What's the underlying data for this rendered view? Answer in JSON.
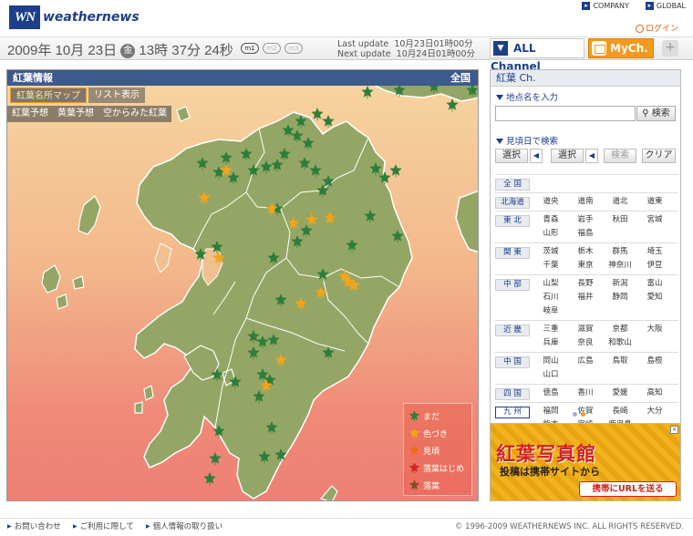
{
  "header": {
    "logo_mark": "WN",
    "logo_text": "weathernews",
    "company": "COMPANY",
    "global": "GLOBAL",
    "login": "ログイン"
  },
  "datebar": {
    "date": "2009年 10月 23日",
    "weekday": "金",
    "time": "13時 37分 24秒",
    "pills": [
      "m1",
      "m2",
      "m3"
    ],
    "last_update_label": "Last update",
    "last_update": "10月23日01時00分",
    "next_update_label": "Next update",
    "next_update": "10月24日01時00分"
  },
  "channels": {
    "all": "ALL Channel",
    "my": "MyCh.",
    "plus": "+"
  },
  "map": {
    "title": "紅葉情報",
    "region": "全国",
    "tabs": [
      "紅葉名所マップ",
      "リスト表示"
    ],
    "subtabs": [
      "紅葉予想",
      "黄葉予想",
      "空からみた紅葉"
    ],
    "legend": [
      {
        "label": "まだ",
        "color": "#2e7d3a"
      },
      {
        "label": "色づき",
        "color": "#f3a41a"
      },
      {
        "label": "見頃",
        "color": "#ef6a1a"
      },
      {
        "label": "落葉はじめ",
        "color": "#d42424"
      },
      {
        "label": "落葉",
        "color": "#8a4a26"
      }
    ]
  },
  "right": {
    "title": "紅葉 Ch.",
    "search_label": "地点名を入力",
    "search_button": "検索",
    "filter_label": "見頃日で検索",
    "select1": "選択",
    "select2": "選択",
    "search2": "検索",
    "clear": "クリア",
    "regions": [
      {
        "name": "全 国",
        "prefs": []
      },
      {
        "name": "北海道",
        "prefs": [
          "道央",
          "道南",
          "道北",
          "道東"
        ]
      },
      {
        "name": "東 北",
        "prefs": [
          "青森",
          "岩手",
          "秋田",
          "宮城",
          "山形",
          "福島"
        ]
      },
      {
        "name": "関 東",
        "prefs": [
          "茨城",
          "栃木",
          "群馬",
          "埼玉",
          "千葉",
          "東京",
          "神奈川",
          "伊豆"
        ]
      },
      {
        "name": "中 部",
        "prefs": [
          "山梨",
          "長野",
          "新潟",
          "富山",
          "石川",
          "福井",
          "静岡",
          "愛知",
          "岐阜"
        ]
      },
      {
        "name": "近 畿",
        "prefs": [
          "三重",
          "滋賀",
          "京都",
          "大阪",
          "兵庫",
          "奈良",
          "和歌山"
        ]
      },
      {
        "name": "中 国",
        "prefs": [
          "岡山",
          "広島",
          "鳥取",
          "島根",
          "山口"
        ]
      },
      {
        "name": "四 国",
        "prefs": [
          "徳島",
          "香川",
          "愛媛",
          "高知"
        ]
      },
      {
        "name": "九 州",
        "prefs": [
          "福岡",
          "佐賀",
          "長崎",
          "大分",
          "熊本",
          "宮崎",
          "鹿児島"
        ]
      }
    ]
  },
  "banner": {
    "title": "紅葉写真館",
    "subtitle": "投稿は携帯サイトから",
    "button": "携帯にURLを送る",
    "close": "×"
  },
  "footer": {
    "links": [
      "お問い合わせ",
      "ご利用に際して",
      "個人情報の取り扱い"
    ],
    "copyright": "© 1996-2009 WEATHERNEWS INC. ALL RIGHTS RESERVED."
  }
}
